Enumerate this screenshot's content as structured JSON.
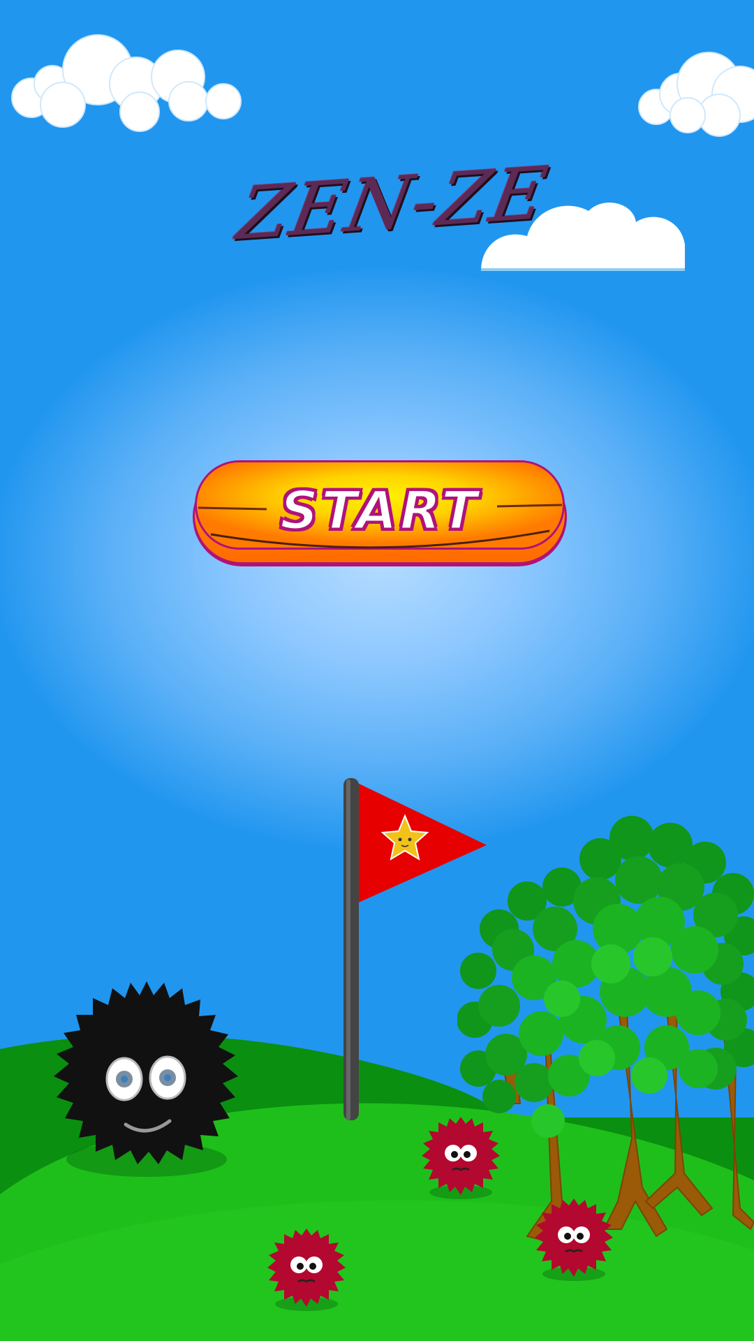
{
  "game": {
    "title": "ZEN-ZE",
    "start_label": "START"
  },
  "colors": {
    "sky_top": "#0c8de8",
    "sky_glow": "#b4dcff",
    "hill_dark": "#0a8f10",
    "hill_light": "#1fbf1b",
    "title": "#5c2a54",
    "button_orange": "#ff8a00",
    "button_yellow": "#ffe600",
    "button_outline": "#b0127a",
    "flag_red": "#e60000",
    "flag_star": "#f2c21b",
    "creature_black": "#111111",
    "creature_red": "#b3082f",
    "tree_trunk": "#a05a0a",
    "tree_leaf": "#16a016"
  },
  "icons": {
    "flag": "flag-with-star-icon",
    "hero": "black-fuzzball-creature",
    "enemy": "red-fuzzball-creature"
  }
}
